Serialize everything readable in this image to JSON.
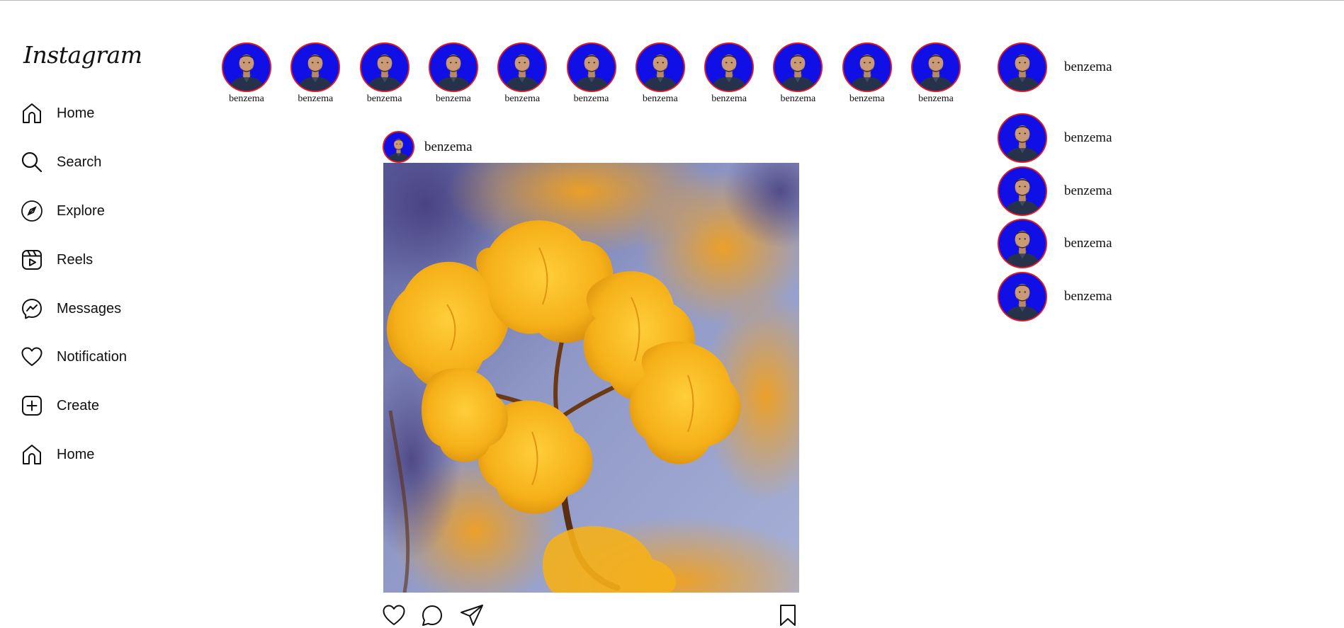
{
  "app": {
    "logo_text": "Instagram"
  },
  "sidebar": {
    "items": [
      {
        "label": "Home",
        "icon": "home-icon"
      },
      {
        "label": "Search",
        "icon": "search-icon"
      },
      {
        "label": "Explore",
        "icon": "compass-icon"
      },
      {
        "label": "Reels",
        "icon": "reels-icon"
      },
      {
        "label": "Messages",
        "icon": "messenger-icon"
      },
      {
        "label": "Notification",
        "icon": "heart-icon"
      },
      {
        "label": "Create",
        "icon": "plus-square-icon"
      },
      {
        "label": "Home",
        "icon": "home-icon"
      }
    ]
  },
  "stories": {
    "items": [
      {
        "label": "benzema"
      },
      {
        "label": "benzema"
      },
      {
        "label": "benzema"
      },
      {
        "label": "benzema"
      },
      {
        "label": "benzema"
      },
      {
        "label": "benzema"
      },
      {
        "label": "benzema"
      },
      {
        "label": "benzema"
      },
      {
        "label": "benzema"
      },
      {
        "label": "benzema"
      },
      {
        "label": "benzema"
      }
    ]
  },
  "post": {
    "username": "benzema",
    "image": "yellow-flower-photo",
    "actions": [
      "heart-icon",
      "comment-icon",
      "share-icon",
      "bookmark-icon"
    ]
  },
  "profile": {
    "username": "benzema"
  },
  "suggestions": {
    "items": [
      {
        "name": "benzema"
      },
      {
        "name": "benzema"
      },
      {
        "name": "benzema"
      },
      {
        "name": "benzema"
      }
    ]
  },
  "colors": {
    "avatar_ring": "#e01b24",
    "avatar_bg": "#1010e6"
  }
}
